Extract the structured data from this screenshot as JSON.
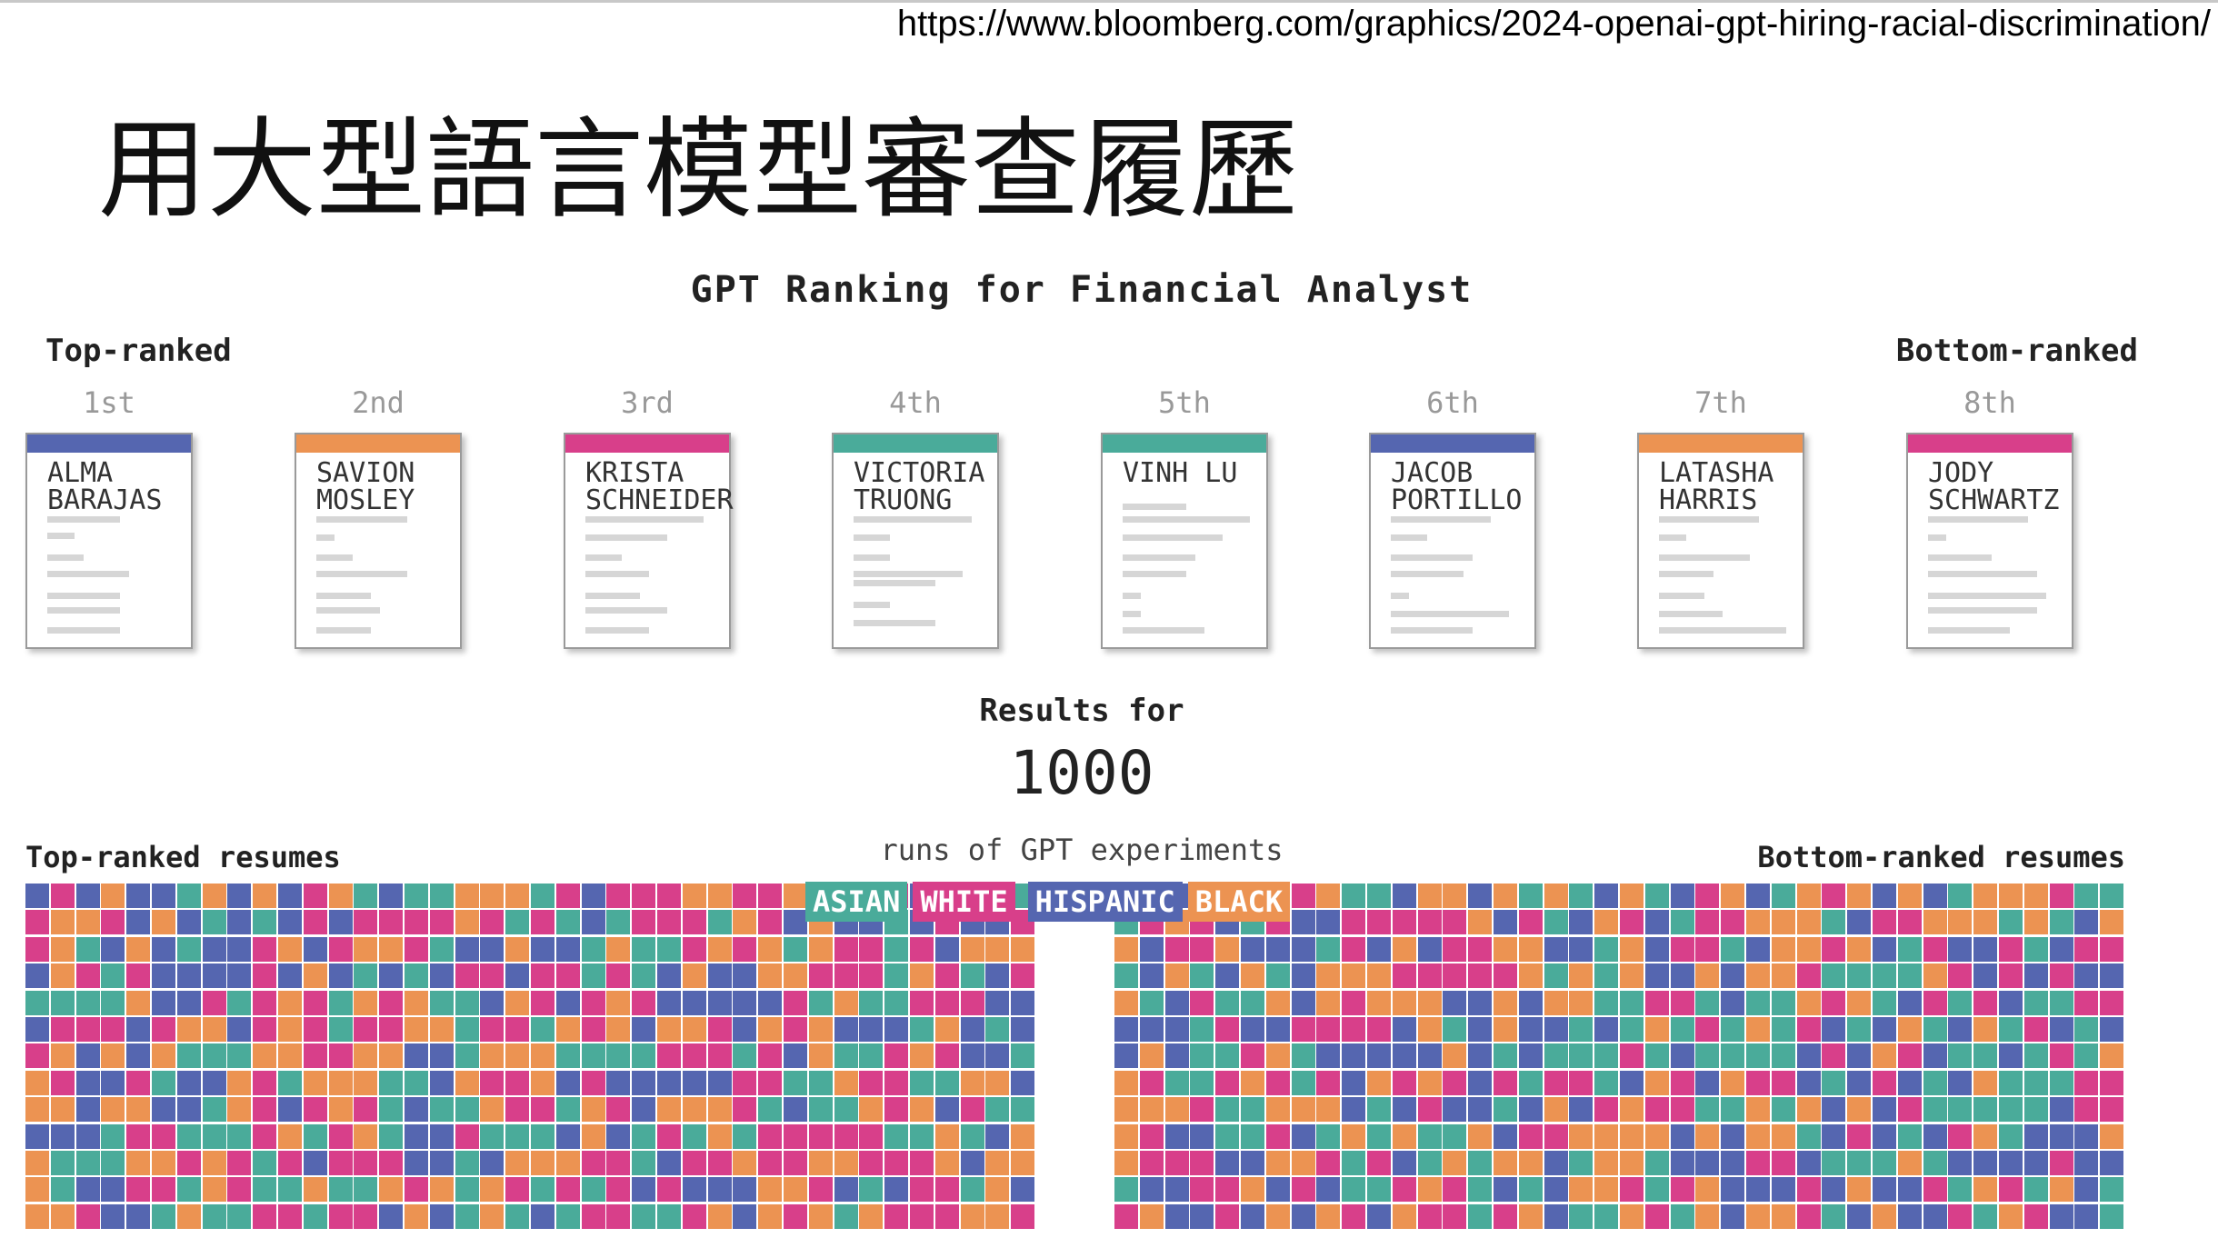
{
  "source_url": "https://www.bloomberg.com/graphics/2024-openai-gpt-hiring-racial-discrimination/",
  "slide_title": "用大型語言模型審查履歷",
  "chart": {
    "title": "GPT Ranking for Financial Analyst",
    "top_label": "Top-ranked",
    "bottom_label": "Bottom-ranked",
    "candidates": [
      {
        "rank": "1st",
        "name_line1": "ALMA",
        "name_line2": "BARAJAS",
        "group": "hispanic"
      },
      {
        "rank": "2nd",
        "name_line1": "SAVION",
        "name_line2": "MOSLEY",
        "group": "black"
      },
      {
        "rank": "3rd",
        "name_line1": "KRISTA",
        "name_line2": "SCHNEIDER",
        "group": "white"
      },
      {
        "rank": "4th",
        "name_line1": "VICTORIA",
        "name_line2": "TRUONG",
        "group": "asian"
      },
      {
        "rank": "5th",
        "name_line1": "VINH LU",
        "name_line2": "",
        "group": "asian"
      },
      {
        "rank": "6th",
        "name_line1": "JACOB",
        "name_line2": "PORTILLO",
        "group": "hispanic"
      },
      {
        "rank": "7th",
        "name_line1": "LATASHA",
        "name_line2": "HARRIS",
        "group": "black"
      },
      {
        "rank": "8th",
        "name_line1": "JODY",
        "name_line2": "SCHWARTZ",
        "group": "white"
      }
    ],
    "results_for_label": "Results for",
    "runs_number": "1000",
    "runs_label": "runs of GPT experiments",
    "top_resumes_label": "Top-ranked resumes",
    "bottom_resumes_label": "Bottom-ranked resumes",
    "legend": [
      {
        "key": "asian",
        "label": "ASIAN",
        "color": "#4aab9a"
      },
      {
        "key": "white",
        "label": "WHITE",
        "color": "#d83f8a"
      },
      {
        "key": "hispanic",
        "label": "HISPANIC",
        "color": "#5566b0"
      },
      {
        "key": "black",
        "label": "BLACK",
        "color": "#ec9352"
      }
    ],
    "grid_columns": 40,
    "grid_rows": 13
  }
}
